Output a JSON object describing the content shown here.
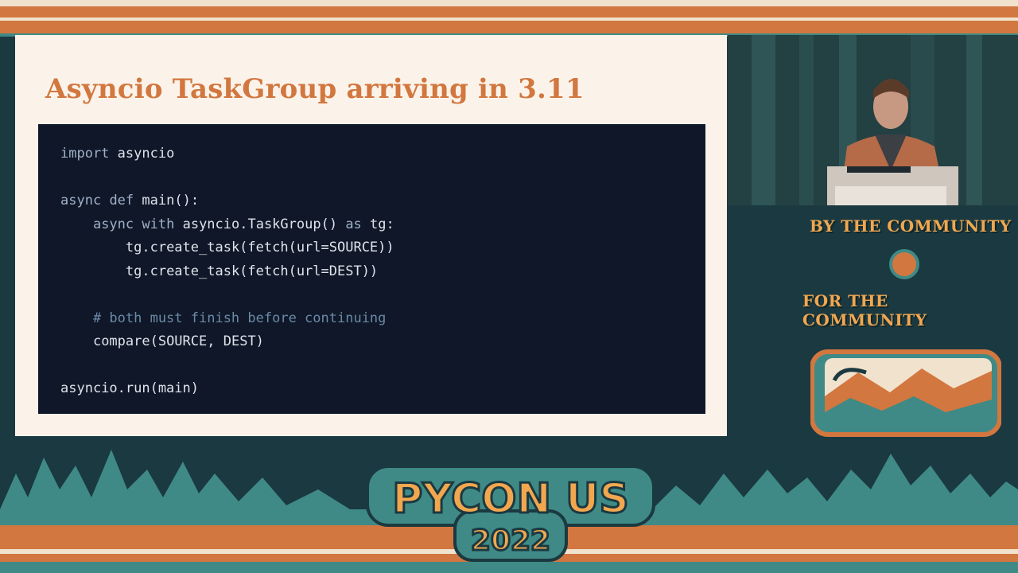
{
  "slide": {
    "title": "Asyncio TaskGroup arriving in 3.11",
    "code_lines": [
      "import asyncio",
      "",
      "async def main():",
      "    async with asyncio.TaskGroup() as tg:",
      "        tg.create_task(fetch(url=SOURCE))",
      "        tg.create_task(fetch(url=DEST))",
      "",
      "    # both must finish before continuing",
      "    compare(SOURCE, DEST)",
      "",
      "asyncio.run(main)"
    ]
  },
  "sidebar": {
    "tagline_top": "BY THE COMMUNITY",
    "tagline_bottom": "FOR THE COMMUNITY"
  },
  "event_logo": {
    "line1": "PYCON US",
    "line2": "2022"
  },
  "colors": {
    "orange": "#d2773f",
    "teal": "#3f8a86",
    "cream": "#f1e2cd",
    "code_bg": "#0f1728",
    "dark_bg": "#1b3940"
  }
}
